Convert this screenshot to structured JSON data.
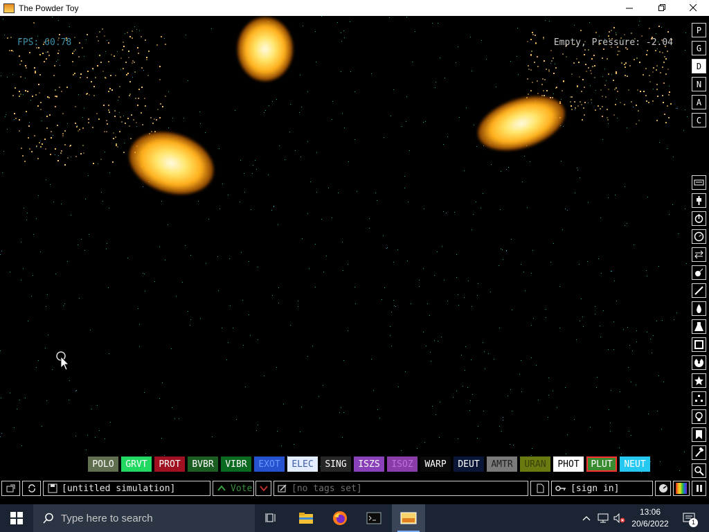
{
  "window": {
    "title": "The Powder Toy",
    "controls": [
      "minimize-icon",
      "maximize-icon",
      "close-icon"
    ]
  },
  "sim": {
    "fps_text": "FPS: 60.78",
    "status_text": "Empty, Pressure: -2.04"
  },
  "modes": [
    "P",
    "G",
    "D",
    "N",
    "A",
    "C"
  ],
  "active_mode": "D",
  "tools": [
    "keyboard-icon",
    "plug-icon",
    "power-icon",
    "pressure-icon",
    "arrows-icon",
    "explosive-icon",
    "pen-icon",
    "drop-icon",
    "flask-icon",
    "square-icon",
    "radiation-icon",
    "star-icon",
    "dots-icon",
    "bulb-icon",
    "bookmark-icon",
    "hammer-icon",
    "magnifier-icon"
  ],
  "elements": [
    {
      "label": "POLO",
      "bg": "#5f6f4f",
      "fg": "#ffffff"
    },
    {
      "label": "GRVT",
      "bg": "#21d860",
      "fg": "#ffffff"
    },
    {
      "label": "PROT",
      "bg": "#a01020",
      "fg": "#ffffff"
    },
    {
      "label": "BVBR",
      "bg": "#1a5e22",
      "fg": "#ffffff"
    },
    {
      "label": "VIBR",
      "bg": "#0a6a20",
      "fg": "#ffffff"
    },
    {
      "label": "EXOT",
      "bg": "#2652d0",
      "fg": "#6a98ff"
    },
    {
      "label": "ELEC",
      "bg": "#e4ecff",
      "fg": "#4060a0"
    },
    {
      "label": "SING",
      "bg": "#262626",
      "fg": "#ffffff"
    },
    {
      "label": "ISZS",
      "bg": "#8a40b8",
      "fg": "#ffffff"
    },
    {
      "label": "ISOZ",
      "bg": "#8a3ca8",
      "fg": "#c070e0"
    },
    {
      "label": "WARP",
      "bg": "#0a0a0a",
      "fg": "#ffffff"
    },
    {
      "label": "DEUT",
      "bg": "#0a1638",
      "fg": "#ffffff"
    },
    {
      "label": "AMTR",
      "bg": "#7a7a7a",
      "fg": "#202020"
    },
    {
      "label": "URAN",
      "bg": "#6a7a10",
      "fg": "#3a4008"
    },
    {
      "label": "PHOT",
      "bg": "#ffffff",
      "fg": "#000000"
    },
    {
      "label": "PLUT",
      "bg": "#3a8a30",
      "fg": "#ffffff"
    },
    {
      "label": "NEUT",
      "bg": "#24c8f0",
      "fg": "#ffffff"
    }
  ],
  "selected_element": "PLUT",
  "bottom": {
    "save_name": "[untitled simulation]",
    "vote_label": "Vote",
    "tags_text": "[no tags set]",
    "signin_text": "[sign in]"
  },
  "taskbar": {
    "search_placeholder": "Type here to search",
    "time": "13:06",
    "date": "20/6/2022",
    "notification_count": "1"
  }
}
